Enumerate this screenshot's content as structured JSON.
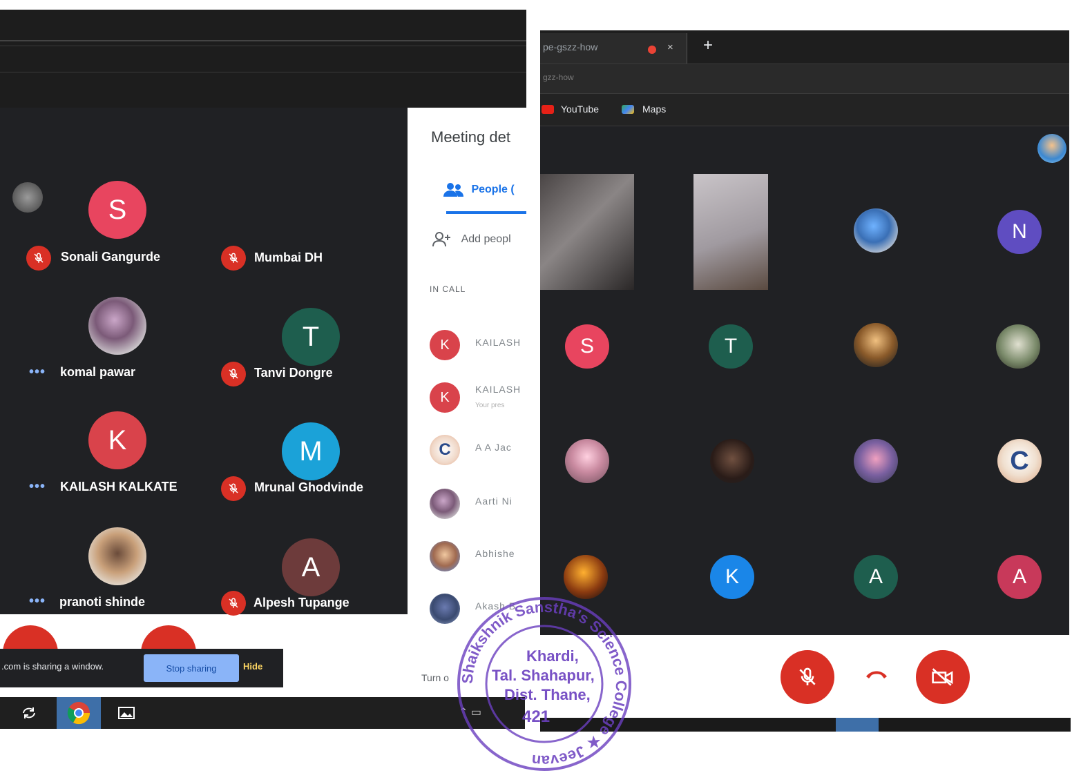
{
  "left": {
    "participants": [
      {
        "name": "Sonali Gangurde",
        "initial": "S",
        "color": "#e8455f",
        "status": "muted"
      },
      {
        "name": "Mumbai DH",
        "initial": "",
        "color": "",
        "status": "muted"
      },
      {
        "name": "komal pawar",
        "initial": "",
        "color": "",
        "status": "dots"
      },
      {
        "name": "Tanvi Dongre",
        "initial": "T",
        "color": "#1e5e4e",
        "status": "muted"
      },
      {
        "name": "KAILASH KALKATE",
        "initial": "K",
        "color": "#d9434b",
        "status": "dots"
      },
      {
        "name": "Mrunal Ghodvinde",
        "initial": "M",
        "color": "#1ba2d8",
        "status": "muted"
      },
      {
        "name": "pranoti shinde",
        "initial": "",
        "color": "",
        "status": "dots"
      },
      {
        "name": "Alpesh Tupange",
        "initial": "A",
        "color": "#6d3b3b",
        "status": "muted"
      }
    ],
    "dots_label": "•••"
  },
  "details": {
    "title": "Meeting det",
    "tab_label": "People (",
    "add_label": "Add peopl",
    "in_call_label": "IN CALL",
    "people": [
      {
        "initial": "K",
        "name": "KAILASH",
        "sub": ""
      },
      {
        "initial": "K",
        "name": "KAILASH",
        "sub": "Your pres"
      },
      {
        "initial": "C",
        "name": "A A Jac",
        "sub": ""
      },
      {
        "initial": "",
        "name": "Aarti Ni",
        "sub": ""
      },
      {
        "initial": "",
        "name": "Abhishe",
        "sub": ""
      },
      {
        "initial": "",
        "name": "Akash B",
        "sub": ""
      }
    ],
    "turn_label": "Turn o"
  },
  "share_bar": {
    "text": ".com is sharing a window.",
    "stop_label": "Stop sharing",
    "hide_label": "Hide"
  },
  "right": {
    "tab_title": "pe-gszz-how",
    "close_glyph": "×",
    "new_tab_glyph": "+",
    "url_text": "gzz-how",
    "bookmarks": [
      "YouTube",
      "Maps"
    ],
    "tiles": [
      {
        "initial": "N",
        "color": "#5f4dc1"
      },
      {
        "initial": "S",
        "color": "#e8455f"
      },
      {
        "initial": "T",
        "color": "#1e5e4e"
      },
      {
        "initial": "C",
        "color": ""
      },
      {
        "initial": "K",
        "color": "#1a86e8"
      },
      {
        "initial": "A",
        "color": "#1e5e4e"
      },
      {
        "initial": "A",
        "color": "#c8395a"
      }
    ]
  },
  "seal": {
    "outer_text": "Shaikshnik Sanstha's Science College ★ Jeevan",
    "line1": "Khardi,",
    "line2": "Tal. Shahapur,",
    "line3": "Dist. Thane,",
    "line4": "421"
  },
  "colors": {
    "meet_dark": "#202124",
    "danger_red": "#d93025",
    "accent_blue": "#1a73e8",
    "seal_purple": "#6a3fbf"
  }
}
